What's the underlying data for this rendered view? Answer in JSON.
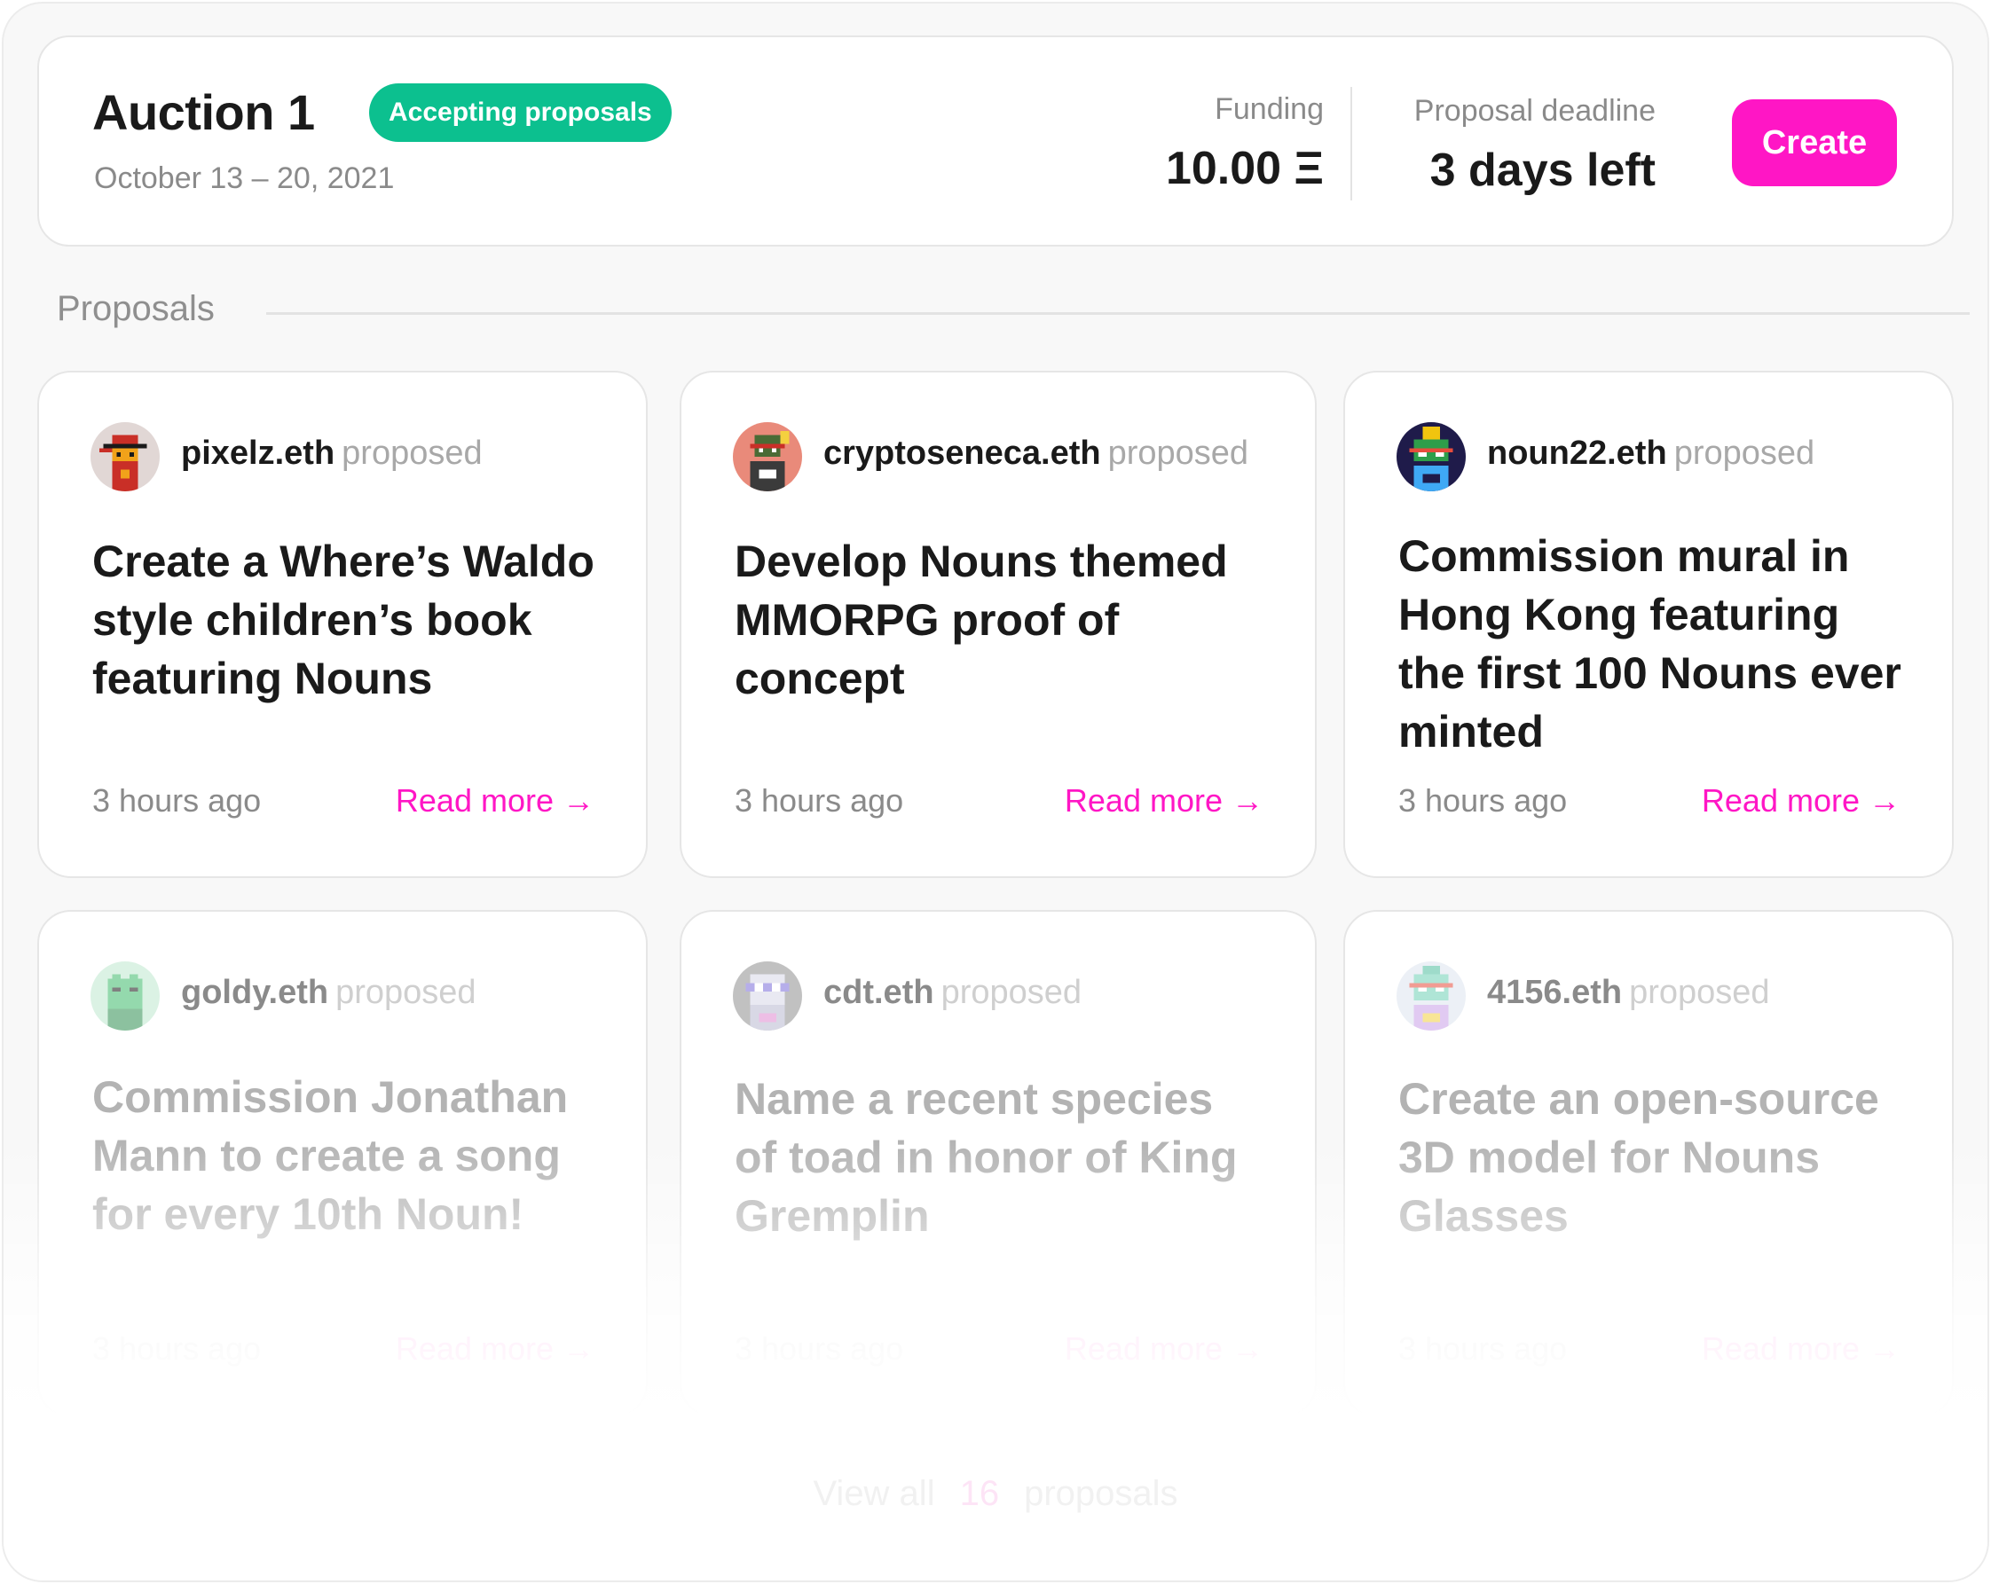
{
  "auction": {
    "title": "Auction 1",
    "status": "Accepting proposals",
    "dates": "October 13 – 20, 2021",
    "funding_label": "Funding",
    "funding_value": "10.00 Ξ",
    "deadline_label": "Proposal deadline",
    "deadline_value": "3 days left",
    "create_label": "Create"
  },
  "proposals_section": {
    "title": "Proposals"
  },
  "proposals": [
    {
      "proposer": "pixelz.eth",
      "verb": "proposed",
      "title": "Create a Where’s Waldo style children’s book featuring Nouns",
      "time": "3 hours ago",
      "read_more": "Read more →",
      "avatar_icon": "noun-avatar-pixelz"
    },
    {
      "proposer": "cryptoseneca.eth",
      "verb": "proposed",
      "title": "Develop Nouns themed MMORPG proof of concept",
      "time": "3 hours ago",
      "read_more": "Read more →",
      "avatar_icon": "noun-avatar-cryptoseneca"
    },
    {
      "proposer": "noun22.eth",
      "verb": "proposed",
      "title": "Commission mural in Hong Kong featuring the first 100 Nouns ever minted",
      "time": "3 hours ago",
      "read_more": "Read more →",
      "avatar_icon": "noun-avatar-noun22"
    },
    {
      "proposer": "goldy.eth",
      "verb": "proposed",
      "title": "Commission Jonathan Mann to create a song for every 10th Noun!",
      "time": "3 hours ago",
      "read_more": "Read more →",
      "avatar_icon": "noun-avatar-goldy"
    },
    {
      "proposer": "cdt.eth",
      "verb": "proposed",
      "title": "Name a recent species of toad in honor of King Gremplin",
      "time": "3 hours ago",
      "read_more": "Read more →",
      "avatar_icon": "noun-avatar-cdt"
    },
    {
      "proposer": "4156.eth",
      "verb": "proposed",
      "title": "Create an open-source 3D model for Nouns Glasses",
      "time": "3 hours ago",
      "read_more": "Read more →",
      "avatar_icon": "noun-avatar-4156"
    }
  ],
  "view_all": {
    "prefix": "View all",
    "count": "16",
    "suffix": "proposals"
  },
  "colors": {
    "accent": "#ff16c5",
    "status_green": "#0cc08f",
    "text_dark": "#1a1a1a",
    "text_muted": "#8a8a8a"
  }
}
